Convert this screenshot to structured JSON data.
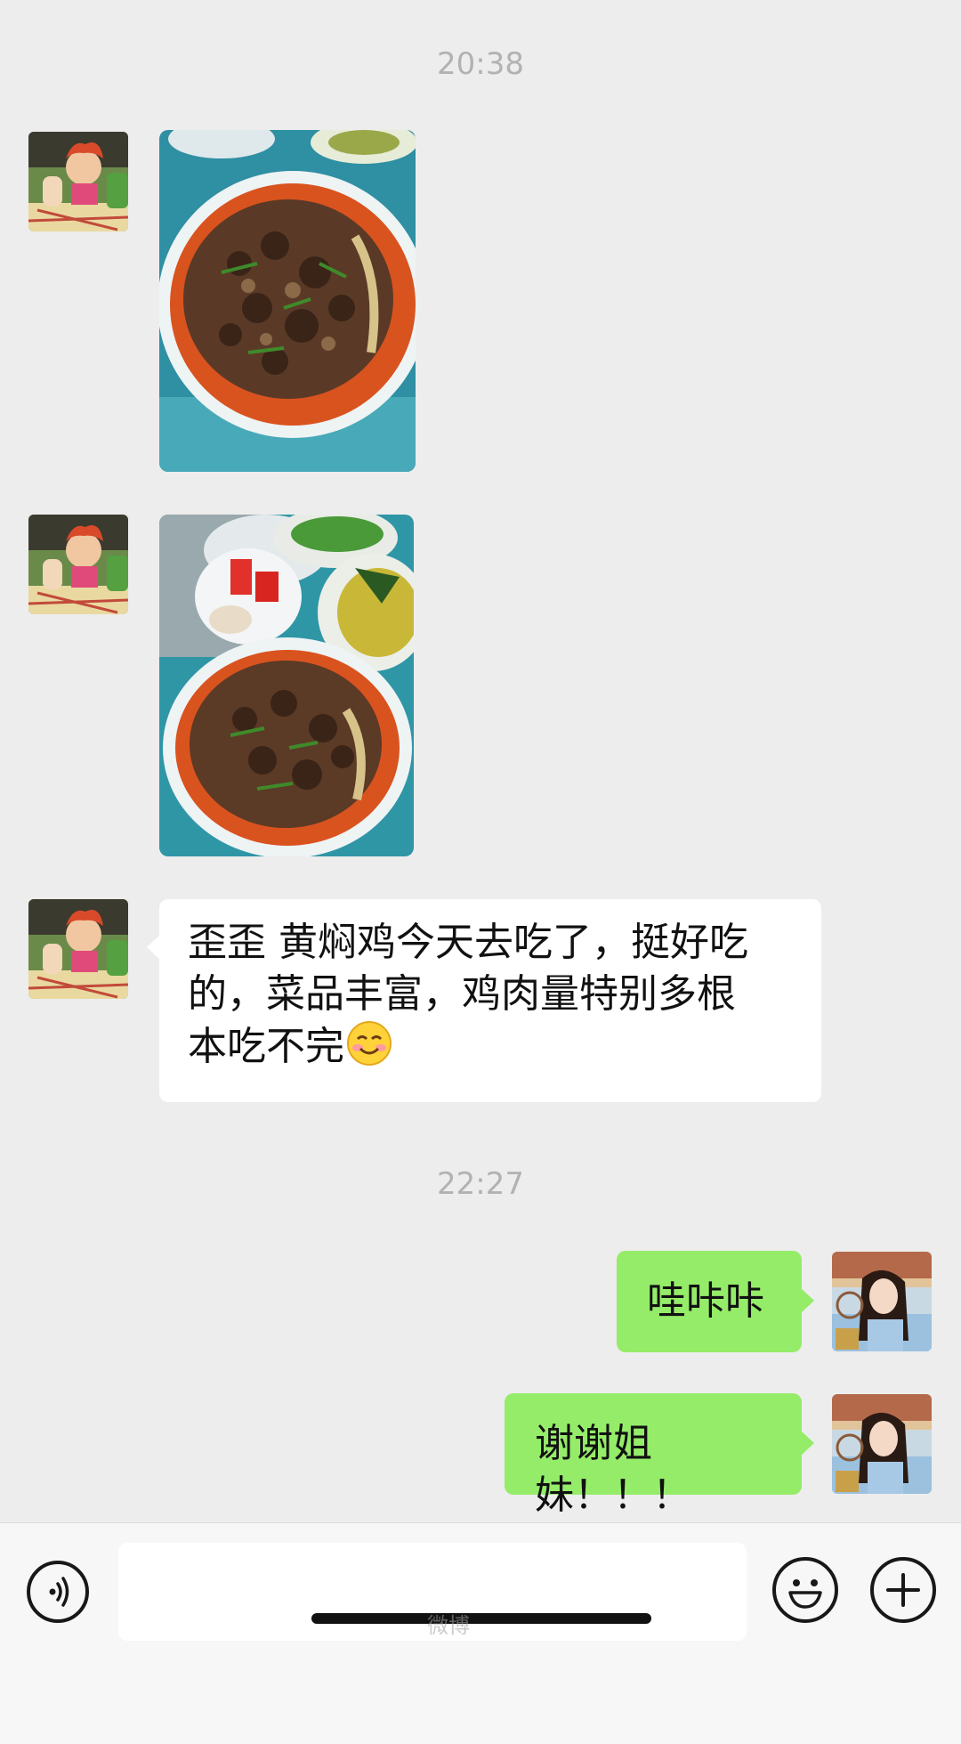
{
  "chat": {
    "timestamps": [
      "20:38",
      "22:27"
    ],
    "messages": {
      "photo_1": {
        "sender": "contact",
        "type": "image",
        "description_icon": "food-photo"
      },
      "photo_2": {
        "sender": "contact",
        "type": "image",
        "description_icon": "food-photo"
      },
      "text_1": {
        "sender": "contact",
        "lines": [
          "歪歪 黄焖鸡今天去吃了，挺好吃",
          "的，菜品丰富，鸡肉量特别多根",
          "本吃不完"
        ],
        "emoji": "smiling-face-emoji"
      },
      "text_2": {
        "sender": "me",
        "text": "哇咔咔"
      },
      "text_3": {
        "sender": "me",
        "text": "谢谢姐妹！！！"
      }
    }
  },
  "input_bar": {
    "voice_icon": "voice-icon",
    "input_value": "",
    "emoji_icon": "emoji-icon",
    "plus_icon": "plus-icon"
  },
  "watermark": "微博",
  "colors": {
    "background": "#ededed",
    "bubble_left": "#ffffff",
    "bubble_right": "#95ec69",
    "timestamp": "#b2b2b2"
  }
}
